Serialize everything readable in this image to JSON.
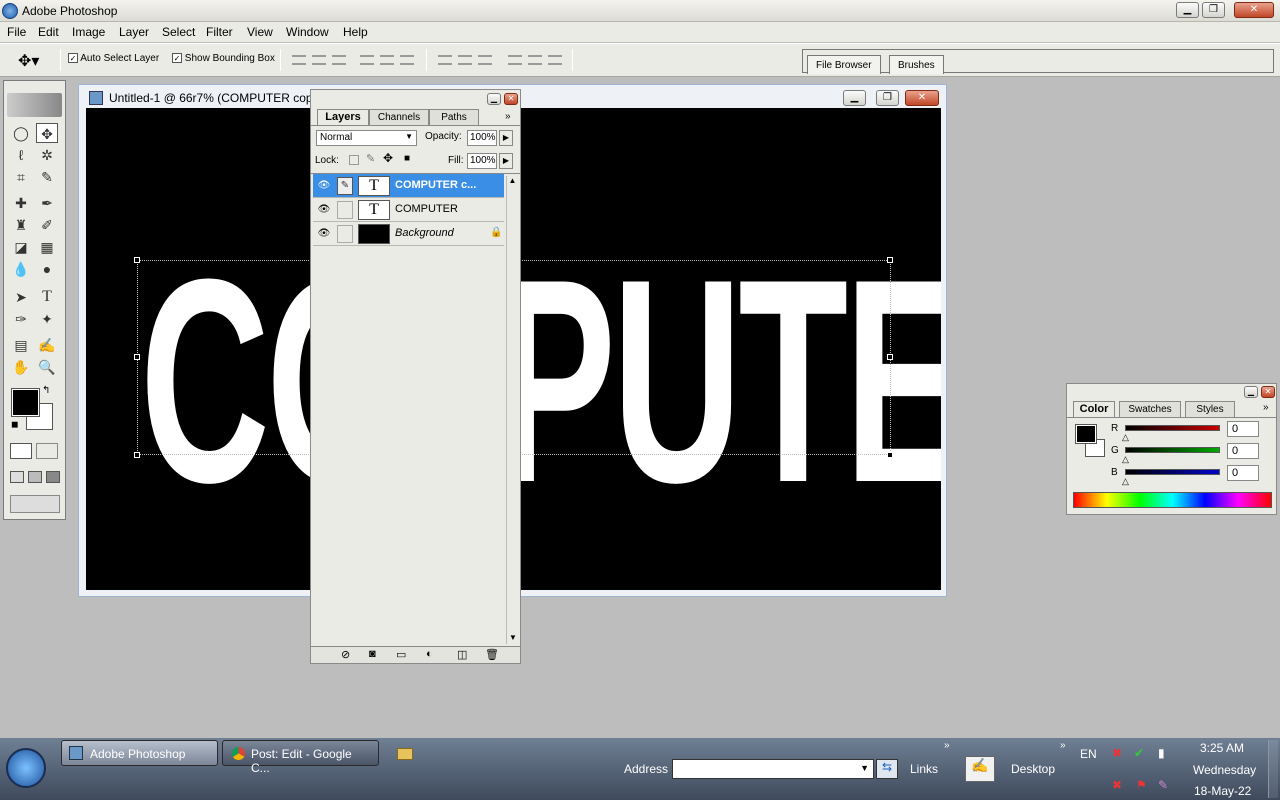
{
  "app": {
    "title": "Adobe Photoshop"
  },
  "window_controls": {
    "minimize": "▁",
    "restore": "❐",
    "close": "✕"
  },
  "menu": [
    "File",
    "Edit",
    "Image",
    "Layer",
    "Select",
    "Filter",
    "View",
    "Window",
    "Help"
  ],
  "options": {
    "auto_select": "Auto Select Layer",
    "bounding_box": "Show Bounding Box"
  },
  "well_tabs": [
    "File Browser",
    "Brushes"
  ],
  "document": {
    "title": "Untitled-1 @ 66r7% (COMPUTER copy",
    "canvas_text_left": "CO",
    "canvas_text_right": "PUTER"
  },
  "layers_panel": {
    "tabs": [
      "Layers",
      "Channels",
      "Paths"
    ],
    "blend_mode": "Normal",
    "opacity_label": "Opacity:",
    "opacity_value": "100%",
    "lock_label": "Lock:",
    "fill_label": "Fill:",
    "fill_value": "100%",
    "layers": [
      {
        "name": "COMPUTER c...",
        "thumb": "T",
        "selected": true
      },
      {
        "name": "COMPUTER",
        "thumb": "T",
        "selected": false
      },
      {
        "name": "Background",
        "thumb": "",
        "selected": false
      }
    ]
  },
  "color_panel": {
    "tabs": [
      "Color",
      "Swatches",
      "Styles"
    ],
    "channels": [
      {
        "label": "R",
        "value": "0",
        "color": "#cc0000"
      },
      {
        "label": "G",
        "value": "0",
        "color": "#00aa00"
      },
      {
        "label": "B",
        "value": "0",
        "color": "#0000cc"
      }
    ]
  },
  "taskbar": {
    "buttons": [
      "Adobe Photoshop",
      "Post: Edit - Google C..."
    ],
    "address_label": "Address",
    "links_label": "Links",
    "desktop_label": "Desktop",
    "lang": "EN",
    "time": "3:25 AM",
    "day": "Wednesday",
    "date": "18-May-22"
  }
}
